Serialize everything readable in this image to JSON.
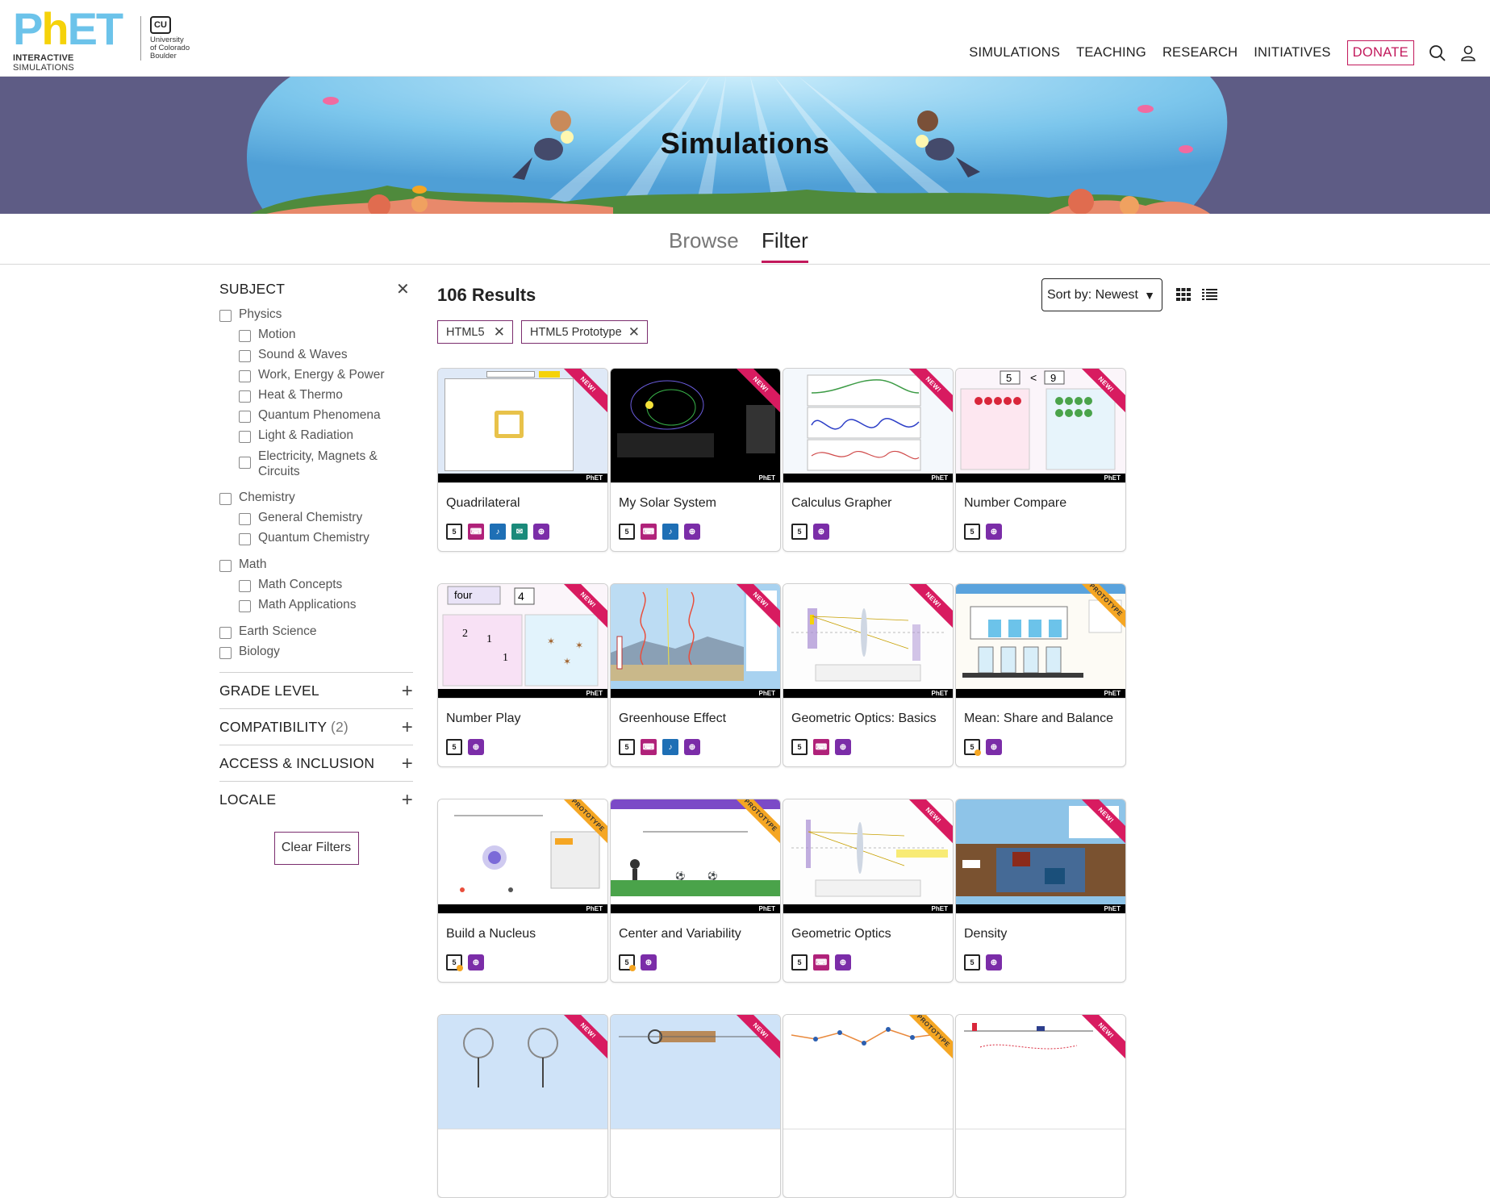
{
  "header": {
    "logo": {
      "p": "P",
      "h": "h",
      "et": "ET",
      "tag_bold": "INTERACTIVE",
      "tag_rest": " SIMULATIONS"
    },
    "cu": {
      "mark": "CU",
      "line1": "University",
      "line2": "of Colorado",
      "line3": "Boulder"
    },
    "nav": [
      "SIMULATIONS",
      "TEACHING",
      "RESEARCH",
      "INITIATIVES"
    ],
    "donate": "DONATE"
  },
  "hero": {
    "title": "Simulations"
  },
  "tabs": {
    "browse": "Browse",
    "filter": "Filter"
  },
  "sidebar": {
    "subject": {
      "title": "SUBJECT",
      "physics": "Physics",
      "physics_items": [
        "Motion",
        "Sound & Waves",
        "Work, Energy & Power",
        "Heat & Thermo",
        "Quantum Phenomena",
        "Light & Radiation"
      ],
      "physics_last": "Electricity, Magnets & Circuits",
      "chemistry": "Chemistry",
      "chemistry_items": [
        "General Chemistry",
        "Quantum Chemistry"
      ],
      "math": "Math",
      "math_items": [
        "Math Concepts",
        "Math Applications"
      ],
      "earth": "Earth Science",
      "biology": "Biology"
    },
    "grade_level": "GRADE LEVEL",
    "compatibility": "COMPATIBILITY",
    "compatibility_count": "(2)",
    "access": "ACCESS & INCLUSION",
    "locale": "LOCALE",
    "clear": "Clear Filters"
  },
  "results": {
    "count": "106 Results",
    "sort_label": "Sort by:",
    "sort_value": "Newest",
    "chips": [
      "HTML5",
      "HTML5 Prototype"
    ]
  },
  "cards": [
    {
      "title": "Quadrilateral",
      "ribbon": "NEW!"
    },
    {
      "title": "My Solar System",
      "ribbon": "NEW!"
    },
    {
      "title": "Calculus Grapher",
      "ribbon": "NEW!"
    },
    {
      "title": "Number Compare",
      "ribbon": "NEW!"
    },
    {
      "title": "Number Play",
      "ribbon": "NEW!"
    },
    {
      "title": "Greenhouse Effect",
      "ribbon": "NEW!"
    },
    {
      "title": "Geometric Optics: Basics",
      "ribbon": "NEW!"
    },
    {
      "title": "Mean: Share and Balance",
      "ribbon": "PROTOTYPE"
    },
    {
      "title": "Build a Nucleus",
      "ribbon": "PROTOTYPE"
    },
    {
      "title": "Center and Variability",
      "ribbon": "PROTOTYPE"
    },
    {
      "title": "Geometric Optics",
      "ribbon": "NEW!"
    },
    {
      "title": "Density",
      "ribbon": "NEW!"
    },
    {
      "title": "",
      "ribbon": "NEW!"
    },
    {
      "title": "",
      "ribbon": "NEW!"
    },
    {
      "title": "",
      "ribbon": "PROTOTYPE"
    },
    {
      "title": "",
      "ribbon": "NEW!"
    }
  ],
  "icons": {
    "html5": "html5-icon",
    "prototype": "html5-prototype-icon",
    "keyboard": "keyboard-icon",
    "sound": "sound-icon",
    "voicing": "voicing-icon",
    "zoom": "zoom-icon"
  }
}
